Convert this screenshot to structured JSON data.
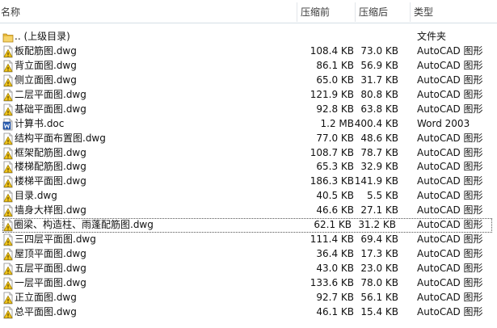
{
  "columns": {
    "name": "名称",
    "original_size": "压缩前",
    "compressed_size": "压缩后",
    "type": "类型"
  },
  "parent": {
    "name": ".. (上级目录)",
    "type": "文件夹",
    "icon": "folder-icon"
  },
  "files": [
    {
      "name": "板配筋图.dwg",
      "original": "108.4 KB",
      "compressed": "73.0 KB",
      "type": "AutoCAD 图形",
      "icon": "dwg-file-icon"
    },
    {
      "name": "背立面图.dwg",
      "original": "86.1 KB",
      "compressed": "56.9 KB",
      "type": "AutoCAD 图形",
      "icon": "dwg-file-icon"
    },
    {
      "name": "侧立面图.dwg",
      "original": "65.0 KB",
      "compressed": "31.7 KB",
      "type": "AutoCAD 图形",
      "icon": "dwg-file-icon"
    },
    {
      "name": "二层平面图.dwg",
      "original": "121.9 KB",
      "compressed": "80.8 KB",
      "type": "AutoCAD 图形",
      "icon": "dwg-file-icon"
    },
    {
      "name": "基础平面图.dwg",
      "original": "92.8 KB",
      "compressed": "63.8 KB",
      "type": "AutoCAD 图形",
      "icon": "dwg-file-icon"
    },
    {
      "name": "计算书.doc",
      "original": "1.2 MB",
      "compressed": "400.4 KB",
      "type": "Word 2003",
      "icon": "word-doc-icon"
    },
    {
      "name": "结构平面布置图.dwg",
      "original": "77.0 KB",
      "compressed": "48.6 KB",
      "type": "AutoCAD 图形",
      "icon": "dwg-file-icon"
    },
    {
      "name": "框架配筋图.dwg",
      "original": "108.7 KB",
      "compressed": "78.7 KB",
      "type": "AutoCAD 图形",
      "icon": "dwg-file-icon"
    },
    {
      "name": "楼梯配筋图.dwg",
      "original": "65.3 KB",
      "compressed": "32.9 KB",
      "type": "AutoCAD 图形",
      "icon": "dwg-file-icon"
    },
    {
      "name": "楼梯平面图.dwg",
      "original": "186.3 KB",
      "compressed": "141.9 KB",
      "type": "AutoCAD 图形",
      "icon": "dwg-file-icon"
    },
    {
      "name": "目录.dwg",
      "original": "40.5 KB",
      "compressed": "5.5 KB",
      "type": "AutoCAD 图形",
      "icon": "dwg-file-icon"
    },
    {
      "name": "墙身大样图.dwg",
      "original": "46.6 KB",
      "compressed": "27.1 KB",
      "type": "AutoCAD 图形",
      "icon": "dwg-file-icon"
    },
    {
      "name": "圈梁、构造柱、雨蓬配筋图.dwg",
      "original": "62.1 KB",
      "compressed": "31.2 KB",
      "type": "AutoCAD 图形",
      "icon": "dwg-file-icon",
      "focused": true
    },
    {
      "name": "三四层平面图.dwg",
      "original": "111.4 KB",
      "compressed": "69.4 KB",
      "type": "AutoCAD 图形",
      "icon": "dwg-file-icon"
    },
    {
      "name": "屋顶平面图.dwg",
      "original": "36.4 KB",
      "compressed": "17.3 KB",
      "type": "AutoCAD 图形",
      "icon": "dwg-file-icon"
    },
    {
      "name": "五层平面图.dwg",
      "original": "43.0 KB",
      "compressed": "23.0 KB",
      "type": "AutoCAD 图形",
      "icon": "dwg-file-icon"
    },
    {
      "name": "一层平面图.dwg",
      "original": "133.6 KB",
      "compressed": "78.0 KB",
      "type": "AutoCAD 图形",
      "icon": "dwg-file-icon"
    },
    {
      "name": "正立面图.dwg",
      "original": "92.7 KB",
      "compressed": "56.1 KB",
      "type": "AutoCAD 图形",
      "icon": "dwg-file-icon"
    },
    {
      "name": "总平面图.dwg",
      "original": "46.1 KB",
      "compressed": "15.4 KB",
      "type": "AutoCAD 图形",
      "icon": "dwg-file-icon"
    }
  ]
}
